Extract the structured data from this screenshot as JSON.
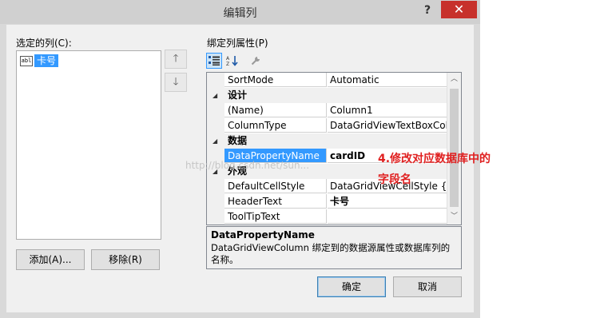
{
  "dialog": {
    "title": "编辑列",
    "help": "?",
    "close": "✕"
  },
  "selected_columns_label": "选定的列(C):",
  "columns_list": [
    {
      "icon": "abl",
      "label": "卡号"
    }
  ],
  "move_up_glyph": "🡑",
  "move_down_glyph": "🡓",
  "add_button": "添加(A)...",
  "remove_button": "移除(R)",
  "properties_label": "绑定列属性(P)",
  "property_rows": [
    {
      "type": "prop",
      "name": "SortMode",
      "value": "Automatic"
    },
    {
      "type": "cat",
      "name": "设计"
    },
    {
      "type": "prop",
      "name": "(Name)",
      "value": "Column1"
    },
    {
      "type": "prop",
      "name": "ColumnType",
      "value": "DataGridViewTextBoxColu"
    },
    {
      "type": "cat",
      "name": "数据"
    },
    {
      "type": "prop",
      "name": "DataPropertyName",
      "value": "cardID",
      "selected": true,
      "bold": true
    },
    {
      "type": "cat",
      "name": "外观"
    },
    {
      "type": "prop",
      "name": "DefaultCellStyle",
      "value": "DataGridViewCellStyle { }"
    },
    {
      "type": "prop",
      "name": "HeaderText",
      "value": "卡号",
      "bold": true
    },
    {
      "type": "prop",
      "name": "ToolTipText",
      "value": ""
    }
  ],
  "description": {
    "title": "DataPropertyName",
    "text": "DataGridViewColumn 绑定到的数据源属性或数据库列的名称。"
  },
  "ok_button": "确定",
  "cancel_button": "取消",
  "annotation": {
    "line1": "4.修改对应数据库中的",
    "line2": "字段名"
  },
  "watermark": "http://blog.csdn.net/sun...",
  "colors": {
    "selection": "#3399ff",
    "close": "#c7312b",
    "annotation": "#e02020"
  }
}
